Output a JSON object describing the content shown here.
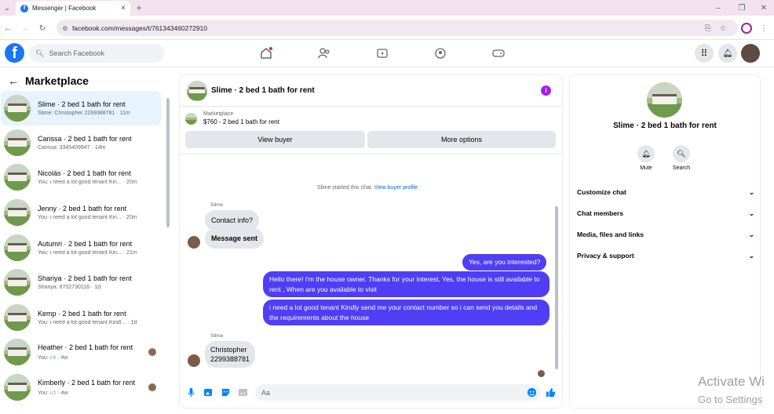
{
  "browser": {
    "tab_title": "Messenger | Facebook",
    "url": "facebook.com/messages/t/761343460272910",
    "new_tab_label": "+"
  },
  "header": {
    "search_placeholder": "Search Facebook"
  },
  "sidebar": {
    "title": "Marketplace",
    "items": [
      {
        "name": "Slime · 2 bed 1 bath for rent",
        "preview": "Slime: Christopher 2299388781",
        "time": "· 11m",
        "active": true
      },
      {
        "name": "Carissa · 2 bed 1 bath for rent",
        "preview": "Carissa: 3345409947",
        "time": "· 14m"
      },
      {
        "name": "Nicolás · 2 bed 1 bath for rent",
        "preview": "You: i need a lot good tenant Kin...",
        "time": "· 20m"
      },
      {
        "name": "Jenny · 2 bed 1 bath for rent",
        "preview": "You: i need a lot good tenant Kin...",
        "time": "· 20m"
      },
      {
        "name": "Autumn · 2 bed 1 bath for rent",
        "preview": "You: i need a lot good tenant Kin...",
        "time": "· 21m"
      },
      {
        "name": "Shariya · 2 bed 1 bath for rent",
        "preview": "Shariya: 8702730116",
        "time": "· 1d"
      },
      {
        "name": "Kemp · 2 bed 1 bath for rent",
        "preview": "You: i need a lot good tenant Kindl...",
        "time": "· 1d"
      },
      {
        "name": "Heather · 2 bed 1 bath for rent",
        "preview": "You:",
        "time": "· 4w"
      },
      {
        "name": "Kimberly · 2 bed 1 bath for rent",
        "preview": "You:",
        "time": "· 4w"
      }
    ]
  },
  "chat": {
    "title": "Slime · 2 bed 1 bath for rent",
    "marketplace_label": "Marketplace",
    "listing": "$760 - 2 bed 1 bath for rent",
    "view_buyer": "View buyer",
    "more_options": "More options",
    "system_text": "Slime started this chat.",
    "system_link": "View buyer profile",
    "sender1": "Slime",
    "in1": "Contact info?",
    "in2": "Message sent",
    "out1": "Yes, are you interested?",
    "out2": "Hello there! I'm the house owner. Thanks for your interest, Yes, the house is still available to rent , When are you available to visit",
    "out3": "i need a lot good tenant Kindly send me your contact number so i can send you details and the requirements about the house",
    "sender2": "Slime",
    "in3_line1": "Christopher",
    "in3_line2": "2299388781",
    "composer_placeholder": "Aa"
  },
  "details": {
    "name": "Slime · 2 bed 1 bath for rent",
    "mute": "Mute",
    "search": "Search",
    "rows": [
      "Customize chat",
      "Chat members",
      "Media, files and links",
      "Privacy & support"
    ]
  },
  "watermark": {
    "line1": "Activate Wi",
    "line2": "Go to Settings"
  },
  "colors": {
    "brand": "#1877f2",
    "outgoing": "#4f3ef5",
    "info": "#a020f0"
  }
}
